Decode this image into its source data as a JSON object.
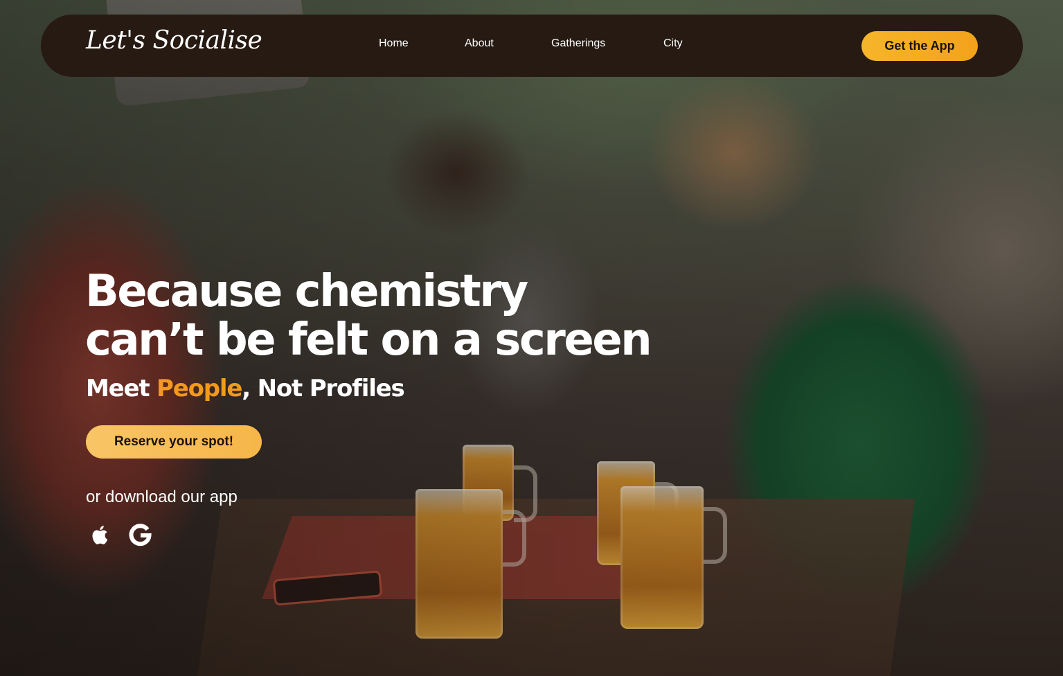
{
  "nav": {
    "logo": "Let's Socialise",
    "links": [
      "Home",
      "About",
      "Gatherings",
      "City"
    ],
    "cta": "Get the App"
  },
  "hero": {
    "headline_line1": "Because chemistry",
    "headline_line2": "can’t be felt on a screen",
    "subhead_prefix": "Meet ",
    "subhead_accent": "People",
    "subhead_suffix": ", Not Profiles",
    "cta": "Reserve your spot!",
    "download_text": "or download our app",
    "store_icons": [
      "apple-icon",
      "google-icon"
    ]
  },
  "colors": {
    "navbar_bg": "#261a12",
    "accent_orange": "#f39a1c",
    "button_yellow": "#f6b52a",
    "reserve_button": "#f8c566",
    "text": "#ffffff"
  }
}
